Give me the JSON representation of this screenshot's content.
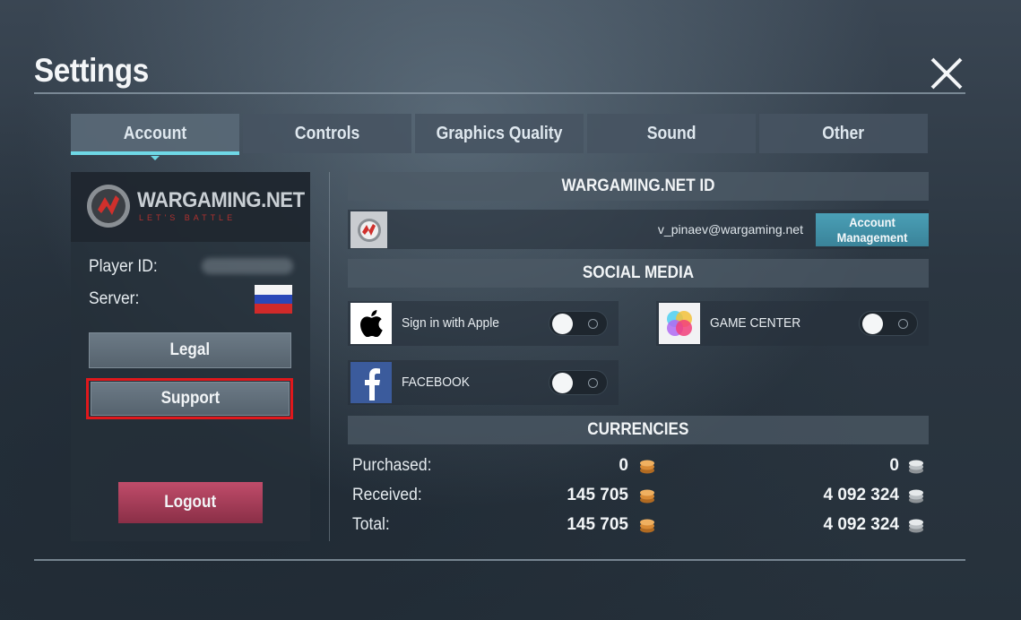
{
  "header": {
    "title": "Settings"
  },
  "tabs": [
    {
      "label": "Account",
      "active": true
    },
    {
      "label": "Controls",
      "active": false
    },
    {
      "label": "Graphics Quality",
      "active": false
    },
    {
      "label": "Sound",
      "active": false
    },
    {
      "label": "Other",
      "active": false
    }
  ],
  "account": {
    "brand": {
      "name": "WARGAMING.NET",
      "tagline": "LET'S BATTLE"
    },
    "player_id_label": "Player ID:",
    "server_label": "Server:",
    "legal_label": "Legal",
    "support_label": "Support",
    "logout_label": "Logout"
  },
  "wargaming_id": {
    "heading": "WARGAMING.NET ID",
    "email": "v_pinaev@wargaming.net",
    "account_button": "Account Management"
  },
  "social": {
    "heading": "SOCIAL MEDIA",
    "items": [
      {
        "label": "Sign in with Apple",
        "icon": "apple-icon",
        "enabled": false
      },
      {
        "label": "GAME CENTER",
        "icon": "game-center-icon",
        "enabled": false
      },
      {
        "label": "FACEBOOK",
        "icon": "facebook-icon",
        "enabled": false
      }
    ]
  },
  "currencies": {
    "heading": "CURRENCIES",
    "rows": [
      {
        "label": "Purchased:",
        "gold": "0",
        "silver": "0"
      },
      {
        "label": "Received:",
        "gold": "145 705",
        "silver": "4 092 324"
      },
      {
        "label": "Total:",
        "gold": "145 705",
        "silver": "4 092 324"
      }
    ]
  },
  "colors": {
    "accent": "#6fd8e6",
    "account_button": "#4a9fb6",
    "logout": "#a83a58",
    "highlight": "#e0181c"
  }
}
